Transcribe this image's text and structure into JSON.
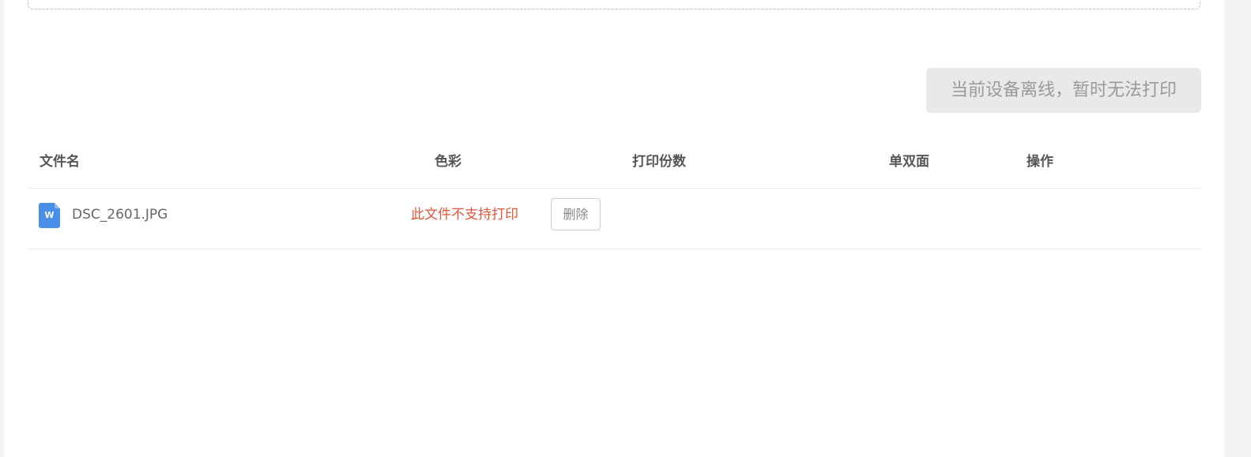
{
  "print_button_label": "当前设备离线，暂时无法打印",
  "table": {
    "headers": {
      "filename": "文件名",
      "color": "色彩",
      "copies": "打印份数",
      "duplex": "单双面",
      "actions": "操作"
    },
    "rows": [
      {
        "file_icon_letter": "W",
        "filename": "DSC_2601.JPG",
        "status": "此文件不支持打印",
        "delete_label": "删除"
      }
    ]
  },
  "icons": {
    "file_icon": "word-document-icon"
  },
  "colors": {
    "status_error": "#e0563b",
    "file_icon_blue": "#4a8fe7",
    "disabled_button_bg": "#e9e9e9"
  }
}
